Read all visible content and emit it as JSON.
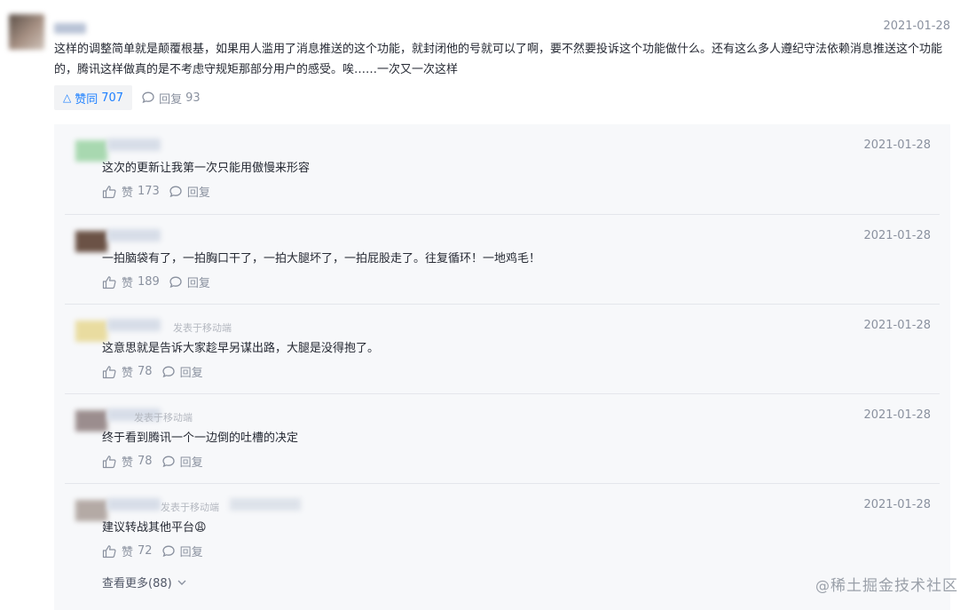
{
  "main_comment": {
    "date": "2021-01-28",
    "text": "这样的调整简单就是颠覆根基，如果用人滥用了消息推送的这个功能，就封闭他的号就可以了啊，要不然要投诉这个功能做什么。还有这么多人遵纪守法依赖消息推送这个功能的，腾讯这样做真的是不考虑守规矩那部分用户的感受。唉……一次又一次这样",
    "like_label": "赞同",
    "like_count": "707",
    "reply_label": "回复",
    "reply_count": "93"
  },
  "replies": [
    {
      "date": "2021-01-28",
      "text": "这次的更新让我第一次只能用傲慢来形容",
      "like_label": "赞",
      "like_count": "173",
      "reply_label": "回复",
      "tag": "",
      "avatar_color": "#a8d8b0"
    },
    {
      "date": "2021-01-28",
      "text": "一拍脑袋有了，一拍胸口干了，一拍大腿坏了，一拍屁股走了。往复循环！一地鸡毛！",
      "like_label": "赞",
      "like_count": "189",
      "reply_label": "回复",
      "tag": "",
      "avatar_color": "#6b5246"
    },
    {
      "date": "2021-01-28",
      "text": "这意思就是告诉大家趁早另谋出路，大腿是没得抱了。",
      "like_label": "赞",
      "like_count": "78",
      "reply_label": "回复",
      "tag": "发表于移动端",
      "avatar_color": "#e9dca0"
    },
    {
      "date": "2021-01-28",
      "text": "终于看到腾讯一个一边倒的吐槽的决定",
      "like_label": "赞",
      "like_count": "78",
      "reply_label": "回复",
      "tag": "发表于移动端",
      "avatar_color": "#9b8d8e"
    },
    {
      "date": "2021-01-28",
      "text": "建议转战其他平台😩",
      "like_label": "赞",
      "like_count": "72",
      "reply_label": "回复",
      "tag": "发表于移动端",
      "avatar_color": "#b4aaa5"
    }
  ],
  "more_label": "查看更多(88)",
  "watermark": "稀土掘金技术社区",
  "watermark_at": "@",
  "colors": {
    "accent": "#1e80ff",
    "muted": "#8a919f",
    "panel": "#f7f8fa"
  }
}
